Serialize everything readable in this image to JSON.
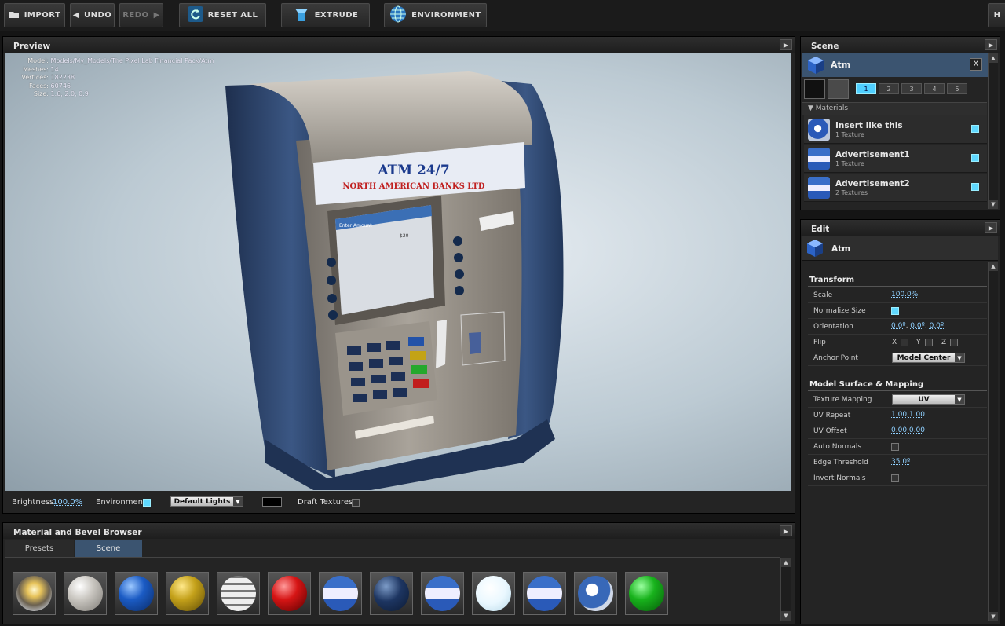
{
  "toolbar": {
    "import": "IMPORT",
    "undo": "UNDO",
    "redo": "REDO",
    "reset_all": "RESET ALL",
    "extrude": "EXTRUDE",
    "environment": "ENVIRONMENT",
    "help": "H"
  },
  "preview": {
    "title": "Preview",
    "info": [
      {
        "label": "Model:",
        "value": "Models/My_Models/The Pixel Lab Financial Pack/Atm"
      },
      {
        "label": "Meshes:",
        "value": "14"
      },
      {
        "label": "Vertices:",
        "value": "182238"
      },
      {
        "label": "Faces:",
        "value": "60746"
      },
      {
        "label": "Size:",
        "value": "1.6, 2.0, 0.9"
      }
    ],
    "atm_sign_line1": "ATM 24/7",
    "atm_sign_line2": "NORTH AMERICAN BANKS LTD",
    "screen_title": "Enter Amount",
    "screen_amount": "$20",
    "screen_text": "In multiples of $20, enter your withdrawal amount and select enter to continue.",
    "screen_hint": "Use the Clear button to make corrections.",
    "screen_cancel": "Cancel",
    "screen_enter": "Enter",
    "screen_clear": "Clear",
    "brightness_label": "Brightness",
    "brightness_value": "100.0%",
    "environment_label": "Environment",
    "lights_value": "Default Lights",
    "draft_label": "Draft Textures"
  },
  "browser": {
    "title": "Material and Bevel Browser",
    "tabs": [
      "Presets",
      "Scene"
    ],
    "active_tab": "Scene"
  },
  "scene": {
    "title": "Scene",
    "object": "Atm",
    "close": "X",
    "slots": [
      "1",
      "2",
      "3",
      "4",
      "5"
    ],
    "materials_label": "Materials",
    "materials": [
      {
        "name": "Insert like this",
        "sub": "1 Texture"
      },
      {
        "name": "Advertisement1",
        "sub": "1 Texture"
      },
      {
        "name": "Advertisement2",
        "sub": "2 Textures"
      }
    ]
  },
  "edit": {
    "title": "Edit",
    "object": "Atm",
    "transform_label": "Transform",
    "scale_label": "Scale",
    "scale_value": "100.0%",
    "normalize_label": "Normalize Size",
    "orientation_label": "Orientation",
    "orient_x": "0.0º",
    "orient_y": "0.0º",
    "orient_z": "0.0º",
    "flip_label": "Flip",
    "flip_x": "X",
    "flip_y": "Y",
    "flip_z": "Z",
    "anchor_label": "Anchor Point",
    "anchor_value": "Model Center",
    "surface_label": "Model Surface & Mapping",
    "mapping_label": "Texture Mapping",
    "mapping_value": "UV",
    "repeat_label": "UV Repeat",
    "repeat_u": "1.00",
    "repeat_v": "1.00",
    "offset_label": "UV Offset",
    "offset_u": "0.00",
    "offset_v": "0.00",
    "auto_normals_label": "Auto Normals",
    "edge_label": "Edge Threshold",
    "edge_value": "35.0º",
    "invert_label": "Invert Normals"
  }
}
